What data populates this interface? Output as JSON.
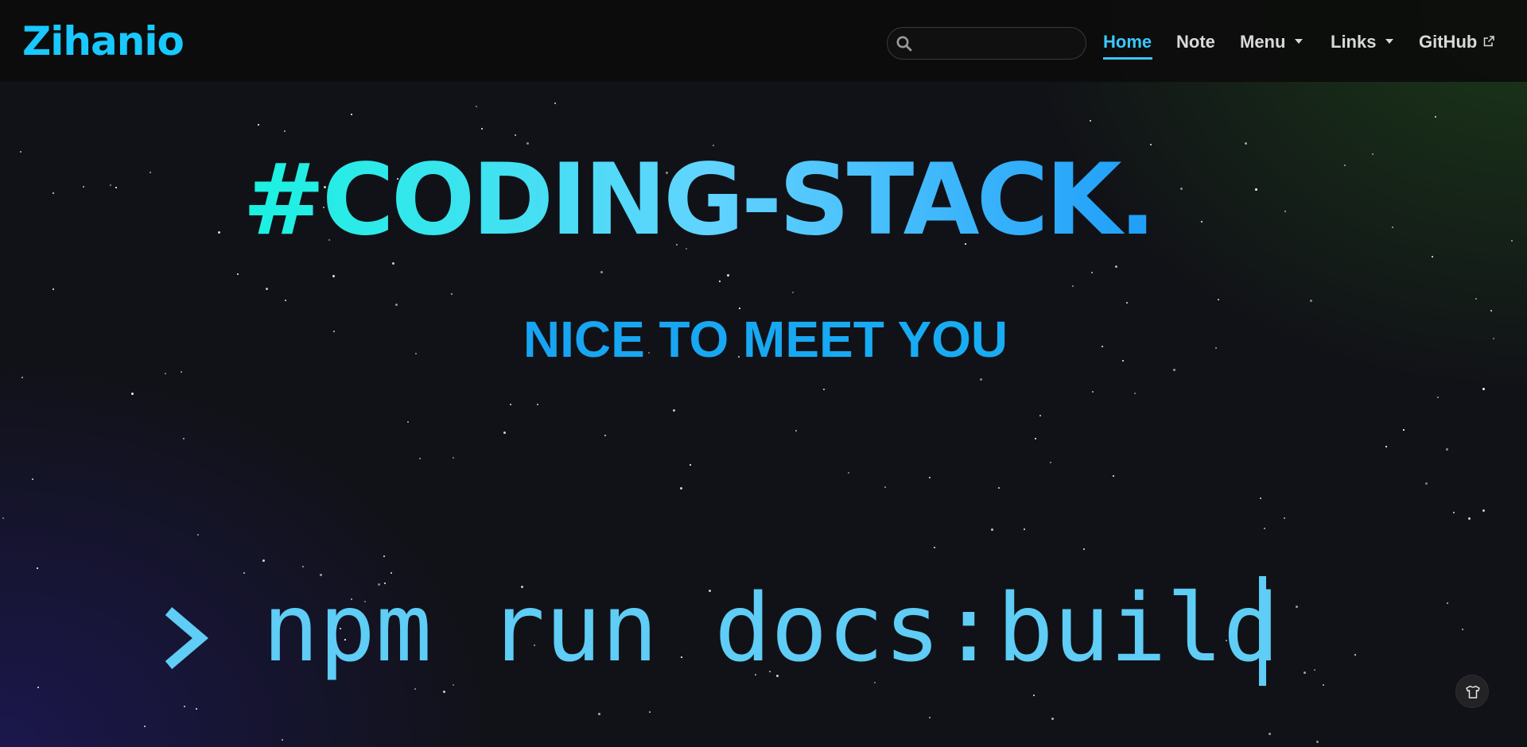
{
  "header": {
    "logo_text": "Zihanio",
    "search": {
      "placeholder": "",
      "value": ""
    },
    "nav": {
      "home": "Home",
      "note": "Note",
      "menu": "Menu",
      "links": "Links",
      "github": "GitHub"
    },
    "active_item": "Home"
  },
  "hero": {
    "title": "#CODING-STACK.",
    "subtitle": "NICE TO MEET YOU",
    "command": "npm run docs:build"
  },
  "icons": {
    "search": "search-icon",
    "menu_dropdown": "caret-down-icon",
    "links_dropdown": "caret-down-icon",
    "github_external": "external-link-icon",
    "prompt": "chevron-right-icon",
    "theme": "shirt-icon"
  },
  "colors": {
    "accent": "#3ac8ff",
    "logo": "#18c8ff",
    "title_gradient_start": "#19f2e0",
    "title_gradient_end": "#0a8ef6",
    "subtitle": "#169af0",
    "terminal_text": "#5fcdf5",
    "navbar_bg": "#0c0c0c",
    "nav_text": "#d9d9d9"
  }
}
